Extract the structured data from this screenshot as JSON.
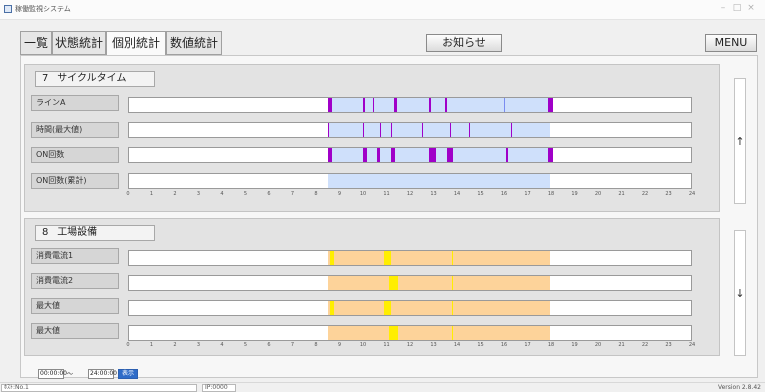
{
  "window": {
    "title": "稼働監視システム",
    "controls": [
      "–",
      "□",
      "×"
    ]
  },
  "tabs": [
    {
      "label": "一覧",
      "active": false
    },
    {
      "label": "状態統計",
      "active": false
    },
    {
      "label": "個別統計",
      "active": true
    },
    {
      "label": "数値統計",
      "active": false
    }
  ],
  "notice_button": "お知らせ",
  "menu_button": "MENU",
  "sections": [
    {
      "number": "7",
      "title": "サイクルタイム",
      "rows": [
        {
          "label": "ラインA"
        },
        {
          "label": "時間(最大値)"
        },
        {
          "label": "ON回数"
        },
        {
          "label": "ON回数(累計)"
        }
      ]
    },
    {
      "number": "8",
      "title": "工場設備",
      "rows": [
        {
          "label": "消費電流1"
        },
        {
          "label": "消費電流2"
        },
        {
          "label": "最大値"
        },
        {
          "label": "最大値"
        }
      ]
    }
  ],
  "axis_ticks": [
    "0",
    "1",
    "2",
    "3",
    "4",
    "5",
    "6",
    "7",
    "8",
    "9",
    "10",
    "11",
    "12",
    "13",
    "14",
    "15",
    "16",
    "17",
    "18",
    "19",
    "20",
    "21",
    "22",
    "23",
    "24"
  ],
  "timeline": {
    "section7_range_hours": [
      8.5,
      18
    ],
    "section8_range_hours": [
      8.5,
      18
    ],
    "colors": {
      "cycle_fill": "#cfe0fb",
      "cycle_mark": "#a000c8",
      "cycle_mark_light": "#7a8cf0",
      "equip_fill": "#fdd39a",
      "equip_mark": "#ffee00"
    },
    "row_marks": {
      "line_a": [
        [
          8.5,
          0.15
        ],
        [
          10,
          0.1
        ],
        [
          10.4,
          0.08
        ],
        [
          11.3,
          0.15
        ],
        [
          12.8,
          0.1
        ],
        [
          13.5,
          0.1
        ],
        [
          16,
          0.05
        ],
        [
          17.9,
          0.2
        ]
      ],
      "time_max": [
        [
          8.5,
          0.05
        ],
        [
          10,
          0.05
        ],
        [
          10.7,
          0.05
        ],
        [
          11.2,
          0.05
        ],
        [
          12.5,
          0.05
        ],
        [
          13.7,
          0.05
        ],
        [
          14.5,
          0.05
        ],
        [
          16.3,
          0.05
        ]
      ],
      "on_count": [
        [
          8.5,
          0.15
        ],
        [
          10,
          0.15
        ],
        [
          10.6,
          0.1
        ],
        [
          11.2,
          0.15
        ],
        [
          12.8,
          0.3
        ],
        [
          13.6,
          0.25
        ],
        [
          16.1,
          0.1
        ],
        [
          17.9,
          0.2
        ]
      ],
      "cur1": [
        [
          8.6,
          0.15
        ],
        [
          10.9,
          0.3
        ],
        [
          13.8,
          0.05
        ]
      ],
      "cur2": [
        [
          11.1,
          0.4
        ],
        [
          13.8,
          0.05
        ]
      ],
      "max1": [
        [
          8.6,
          0.15
        ],
        [
          10.9,
          0.3
        ],
        [
          13.8,
          0.05
        ]
      ],
      "max2": [
        [
          11.1,
          0.4
        ],
        [
          13.8,
          0.05
        ]
      ]
    }
  },
  "scroll_up": "↑",
  "scroll_down": "↓",
  "time_filter": {
    "start": "00:00:00",
    "separator": "〜",
    "end": "24:00:00",
    "button": "表示"
  },
  "status": {
    "left": "ﾎｽﾄ:No.1",
    "middle": "IP:0000",
    "version": "Version 2.8.42"
  }
}
